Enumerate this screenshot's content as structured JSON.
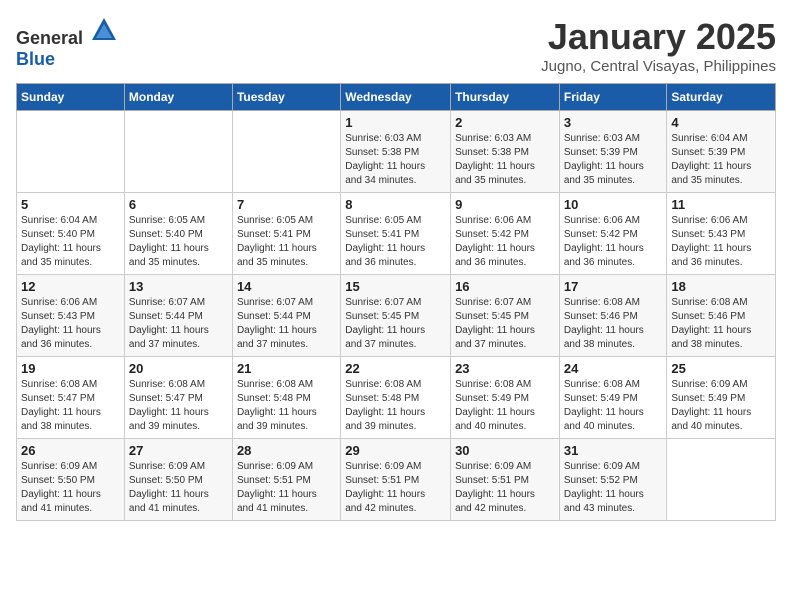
{
  "logo": {
    "general": "General",
    "blue": "Blue"
  },
  "header": {
    "month": "January 2025",
    "location": "Jugno, Central Visayas, Philippines"
  },
  "weekdays": [
    "Sunday",
    "Monday",
    "Tuesday",
    "Wednesday",
    "Thursday",
    "Friday",
    "Saturday"
  ],
  "weeks": [
    [
      {
        "day": "",
        "info": ""
      },
      {
        "day": "",
        "info": ""
      },
      {
        "day": "",
        "info": ""
      },
      {
        "day": "1",
        "info": "Sunrise: 6:03 AM\nSunset: 5:38 PM\nDaylight: 11 hours\nand 34 minutes."
      },
      {
        "day": "2",
        "info": "Sunrise: 6:03 AM\nSunset: 5:38 PM\nDaylight: 11 hours\nand 35 minutes."
      },
      {
        "day": "3",
        "info": "Sunrise: 6:03 AM\nSunset: 5:39 PM\nDaylight: 11 hours\nand 35 minutes."
      },
      {
        "day": "4",
        "info": "Sunrise: 6:04 AM\nSunset: 5:39 PM\nDaylight: 11 hours\nand 35 minutes."
      }
    ],
    [
      {
        "day": "5",
        "info": "Sunrise: 6:04 AM\nSunset: 5:40 PM\nDaylight: 11 hours\nand 35 minutes."
      },
      {
        "day": "6",
        "info": "Sunrise: 6:05 AM\nSunset: 5:40 PM\nDaylight: 11 hours\nand 35 minutes."
      },
      {
        "day": "7",
        "info": "Sunrise: 6:05 AM\nSunset: 5:41 PM\nDaylight: 11 hours\nand 35 minutes."
      },
      {
        "day": "8",
        "info": "Sunrise: 6:05 AM\nSunset: 5:41 PM\nDaylight: 11 hours\nand 36 minutes."
      },
      {
        "day": "9",
        "info": "Sunrise: 6:06 AM\nSunset: 5:42 PM\nDaylight: 11 hours\nand 36 minutes."
      },
      {
        "day": "10",
        "info": "Sunrise: 6:06 AM\nSunset: 5:42 PM\nDaylight: 11 hours\nand 36 minutes."
      },
      {
        "day": "11",
        "info": "Sunrise: 6:06 AM\nSunset: 5:43 PM\nDaylight: 11 hours\nand 36 minutes."
      }
    ],
    [
      {
        "day": "12",
        "info": "Sunrise: 6:06 AM\nSunset: 5:43 PM\nDaylight: 11 hours\nand 36 minutes."
      },
      {
        "day": "13",
        "info": "Sunrise: 6:07 AM\nSunset: 5:44 PM\nDaylight: 11 hours\nand 37 minutes."
      },
      {
        "day": "14",
        "info": "Sunrise: 6:07 AM\nSunset: 5:44 PM\nDaylight: 11 hours\nand 37 minutes."
      },
      {
        "day": "15",
        "info": "Sunrise: 6:07 AM\nSunset: 5:45 PM\nDaylight: 11 hours\nand 37 minutes."
      },
      {
        "day": "16",
        "info": "Sunrise: 6:07 AM\nSunset: 5:45 PM\nDaylight: 11 hours\nand 37 minutes."
      },
      {
        "day": "17",
        "info": "Sunrise: 6:08 AM\nSunset: 5:46 PM\nDaylight: 11 hours\nand 38 minutes."
      },
      {
        "day": "18",
        "info": "Sunrise: 6:08 AM\nSunset: 5:46 PM\nDaylight: 11 hours\nand 38 minutes."
      }
    ],
    [
      {
        "day": "19",
        "info": "Sunrise: 6:08 AM\nSunset: 5:47 PM\nDaylight: 11 hours\nand 38 minutes."
      },
      {
        "day": "20",
        "info": "Sunrise: 6:08 AM\nSunset: 5:47 PM\nDaylight: 11 hours\nand 39 minutes."
      },
      {
        "day": "21",
        "info": "Sunrise: 6:08 AM\nSunset: 5:48 PM\nDaylight: 11 hours\nand 39 minutes."
      },
      {
        "day": "22",
        "info": "Sunrise: 6:08 AM\nSunset: 5:48 PM\nDaylight: 11 hours\nand 39 minutes."
      },
      {
        "day": "23",
        "info": "Sunrise: 6:08 AM\nSunset: 5:49 PM\nDaylight: 11 hours\nand 40 minutes."
      },
      {
        "day": "24",
        "info": "Sunrise: 6:08 AM\nSunset: 5:49 PM\nDaylight: 11 hours\nand 40 minutes."
      },
      {
        "day": "25",
        "info": "Sunrise: 6:09 AM\nSunset: 5:49 PM\nDaylight: 11 hours\nand 40 minutes."
      }
    ],
    [
      {
        "day": "26",
        "info": "Sunrise: 6:09 AM\nSunset: 5:50 PM\nDaylight: 11 hours\nand 41 minutes."
      },
      {
        "day": "27",
        "info": "Sunrise: 6:09 AM\nSunset: 5:50 PM\nDaylight: 11 hours\nand 41 minutes."
      },
      {
        "day": "28",
        "info": "Sunrise: 6:09 AM\nSunset: 5:51 PM\nDaylight: 11 hours\nand 41 minutes."
      },
      {
        "day": "29",
        "info": "Sunrise: 6:09 AM\nSunset: 5:51 PM\nDaylight: 11 hours\nand 42 minutes."
      },
      {
        "day": "30",
        "info": "Sunrise: 6:09 AM\nSunset: 5:51 PM\nDaylight: 11 hours\nand 42 minutes."
      },
      {
        "day": "31",
        "info": "Sunrise: 6:09 AM\nSunset: 5:52 PM\nDaylight: 11 hours\nand 43 minutes."
      },
      {
        "day": "",
        "info": ""
      }
    ]
  ]
}
